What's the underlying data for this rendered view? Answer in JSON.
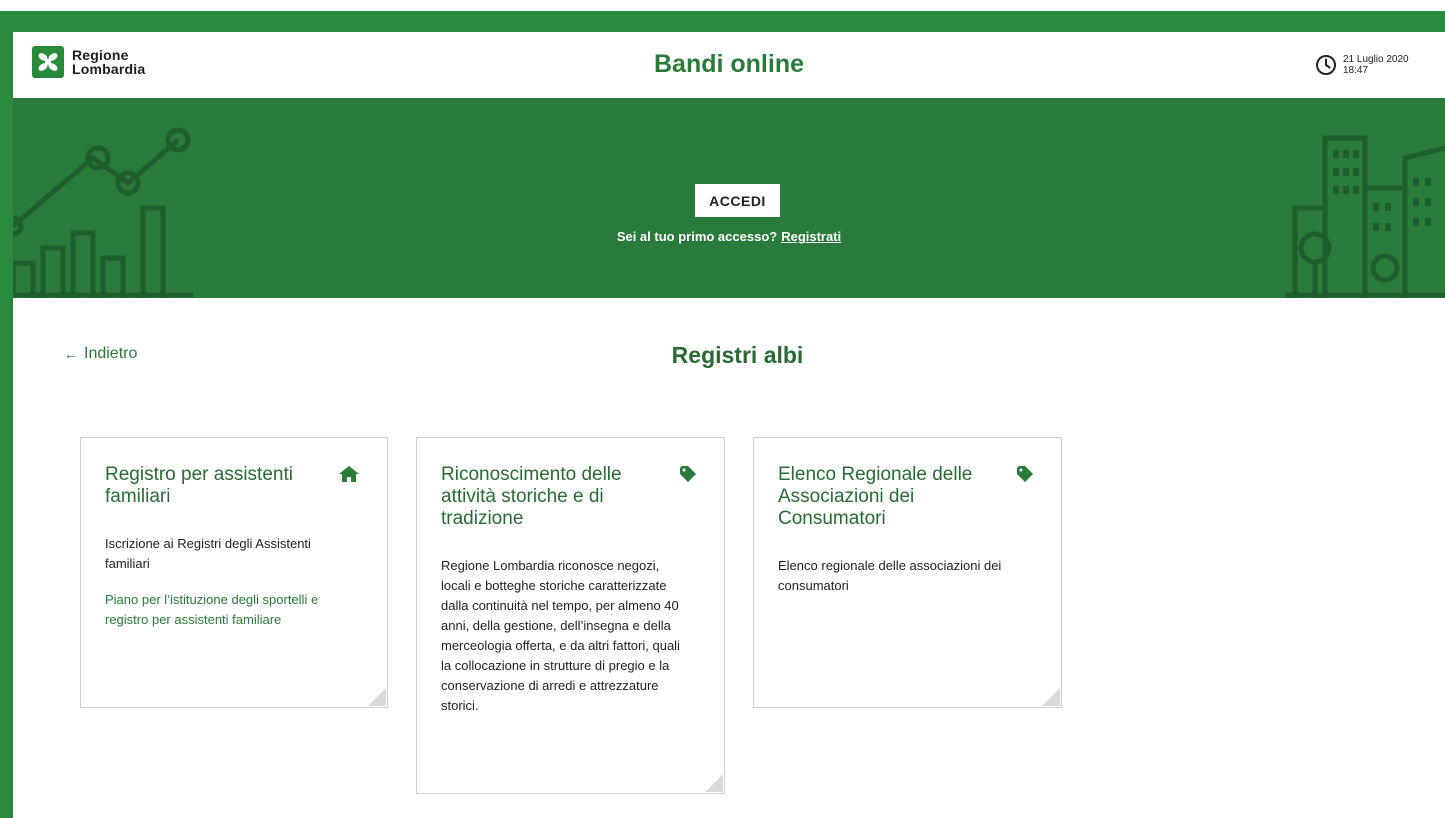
{
  "header": {
    "logo_line1": "Regione",
    "logo_line2": "Lombardia",
    "app_title": "Bandi online",
    "date": "21 Luglio 2020",
    "time": "18:47"
  },
  "banner": {
    "login_label": "ACCEDI",
    "first_access_text": "Sei al tuo primo accesso?",
    "register_link": "Registrati"
  },
  "nav": {
    "back_label": "Indietro"
  },
  "page": {
    "title": "Registri albi"
  },
  "cards": [
    {
      "title": "Registro per assistenti familiari",
      "icon": "home-icon",
      "description": "Iscrizione ai Registri degli Assistenti familiari",
      "link": "Piano per l’istituzione degli sportelli e registro per assistenti familiare"
    },
    {
      "title": "Riconoscimento delle attività storiche e di tradizione",
      "icon": "tag-icon",
      "description": "Regione Lombardia riconosce negozi, locali e botteghe storiche caratterizzate dalla continuità nel tempo, per almeno 40 anni, della gestione, dell’insegna e della merceologia offerta, e da altri fattori, quali la collocazione in strutture di pregio e la conservazione di arredi e attrezzature storici."
    },
    {
      "title": "Elenco Regionale delle Associazioni dei Consumatori",
      "icon": "tag-icon",
      "description": "Elenco regionale delle associazioni dei consumatori"
    }
  ],
  "colors": {
    "brand_green": "#2a8a3c",
    "banner_green": "#2a7a3c",
    "title_green": "#2a6a35"
  }
}
